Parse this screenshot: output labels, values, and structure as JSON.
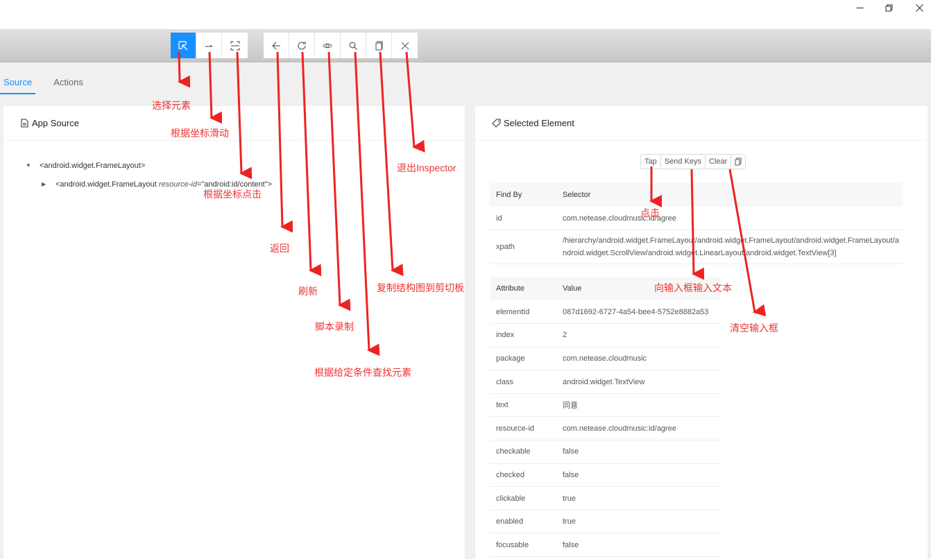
{
  "window": {
    "controls": [
      "minimize",
      "restore",
      "close"
    ]
  },
  "toolbar": {
    "group1": [
      {
        "icon": "select-element-icon",
        "label": "Select Element",
        "active": true
      },
      {
        "icon": "swipe-icon",
        "label": "Swipe By Coordinates",
        "active": false
      },
      {
        "icon": "tap-coordinates-icon",
        "label": "Tap By Coordinates",
        "active": false
      }
    ],
    "group2": [
      {
        "icon": "back-arrow-icon",
        "label": "Back"
      },
      {
        "icon": "refresh-icon",
        "label": "Refresh"
      },
      {
        "icon": "eye-icon",
        "label": "Start Recording"
      },
      {
        "icon": "search-icon",
        "label": "Search Elements"
      },
      {
        "icon": "copy-icon",
        "label": "Copy XML Source"
      },
      {
        "icon": "close-icon",
        "label": "Quit Session"
      }
    ]
  },
  "tabs": [
    {
      "label": "Source",
      "active": true
    },
    {
      "label": "Actions",
      "active": false
    }
  ],
  "source_panel": {
    "title": "App Source",
    "tree": {
      "root": "<android.widget.FrameLayout>",
      "child_tag": "<android.widget.FrameLayout",
      "child_attr_name": "resource-id",
      "child_attr_value": "=\"android:id/content\">"
    }
  },
  "selected_panel": {
    "title": "Selected Element",
    "actions": [
      "Tap",
      "Send Keys",
      "Clear"
    ],
    "findby": {
      "headers": [
        "Find By",
        "Selector"
      ],
      "rows": [
        {
          "by": "id",
          "selector": "com.netease.cloudmusic:id/agree"
        },
        {
          "by": "xpath",
          "selector": "/hierarchy/android.widget.FrameLayout/android.widget.FrameLayout/android.widget.FrameLayout/android.widget.ScrollView/android.widget.LinearLayout/android.widget.TextView[3]"
        }
      ]
    },
    "attributes": {
      "headers": [
        "Attribute",
        "Value"
      ],
      "rows": [
        {
          "name": "elementId",
          "value": "087d1692-6727-4a54-bee4-5752e8882a53"
        },
        {
          "name": "index",
          "value": "2"
        },
        {
          "name": "package",
          "value": "com.netease.cloudmusic"
        },
        {
          "name": "class",
          "value": "android.widget.TextView"
        },
        {
          "name": "text",
          "value": "同意"
        },
        {
          "name": "resource-id",
          "value": "com.netease.cloudmusic:id/agree"
        },
        {
          "name": "checkable",
          "value": "false"
        },
        {
          "name": "checked",
          "value": "false"
        },
        {
          "name": "clickable",
          "value": "true"
        },
        {
          "name": "enabled",
          "value": "true"
        },
        {
          "name": "focusable",
          "value": "false"
        }
      ]
    }
  },
  "annotations": {
    "color": "#ee3333",
    "select_element": "选择元素",
    "swipe": "根据坐标滑动",
    "tap_coords": "根据坐标点击",
    "back": "返回",
    "refresh": "刷新",
    "record": "脚本录制",
    "search": "根据给定条件查找元素",
    "copy": "复制结构图到剪切板",
    "quit": "退出Inspector",
    "tap": "点击",
    "send_keys": "向输入框输入文本",
    "clear": "清空输入框"
  },
  "colors": {
    "accent": "#1890ff",
    "toolbar_bg": "#d4d4d4",
    "page_bg": "#f0f0f0"
  }
}
